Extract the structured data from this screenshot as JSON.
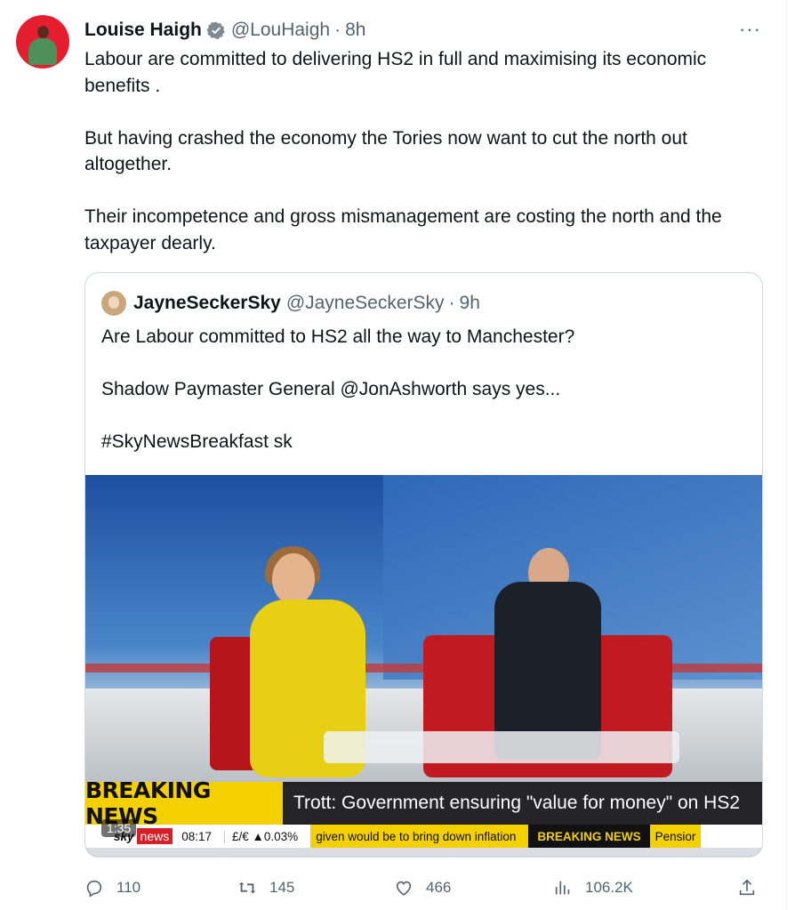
{
  "tweet": {
    "author_name": "Louise Haigh",
    "author_handle": "@LouHaigh",
    "separator": "·",
    "time": "8h",
    "more": "···",
    "paragraphs": [
      "Labour are committed to delivering HS2 in full and maximising its economic benefits .",
      "But having crashed the economy the Tories now want to cut the north out altogether.",
      "Their incompetence and gross mismanagement are costing the north and the taxpayer dearly."
    ]
  },
  "quote": {
    "author_name": "JayneSeckerSky",
    "author_handle": "@JayneSeckerSky",
    "separator": "·",
    "time": "9h",
    "paragraphs": [
      "Are Labour committed to HS2 all the way to Manchester?",
      "Shadow Paymaster General @JonAshworth says yes...",
      "#SkyNewsBreakfast sk"
    ],
    "video": {
      "duration": "1:35",
      "breaking_label": "BREAKING NEWS",
      "headline": "Trott: Government ensuring \"value for money\" on HS2",
      "ticker": {
        "logo": "sky",
        "news": "news",
        "time": "08:17",
        "rate": "£/€ ▲0.03%",
        "scroll": "given would be to bring down inflation",
        "breaking": "BREAKING NEWS",
        "pension": "Pensior"
      }
    }
  },
  "actions": {
    "replies": "110",
    "reposts": "145",
    "likes": "466",
    "views": "106.2K"
  },
  "colors": {
    "text": "#0f1419",
    "secondary": "#536471",
    "verified": "#1d9bf0",
    "border": "#cfd9de",
    "sky_red": "#d61f26",
    "breaking_yellow": "#f4d000"
  },
  "icons": [
    "verified-icon",
    "more-icon",
    "reply-icon",
    "repost-icon",
    "like-icon",
    "views-icon",
    "share-icon"
  ]
}
